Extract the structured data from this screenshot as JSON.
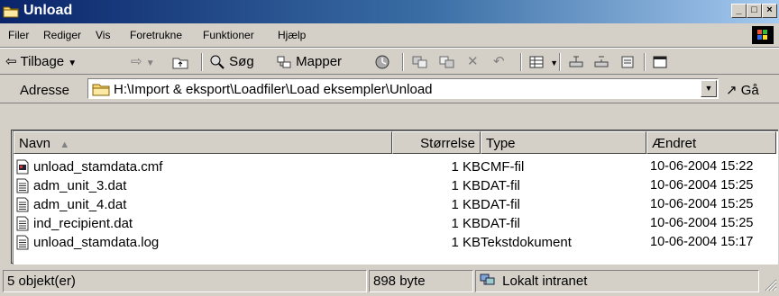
{
  "window": {
    "title": "Unload"
  },
  "menu": [
    "Filer",
    "Rediger",
    "Vis",
    "Foretrukne",
    "Funktioner",
    "Hjælp"
  ],
  "toolbar": {
    "back_label": "Tilbage",
    "search_label": "Søg",
    "folders_label": "Mapper"
  },
  "address": {
    "label": "Adresse",
    "value": "H:\\Import & eksport\\Loadfiler\\Load eksempler\\Unload",
    "go_label": "Gå"
  },
  "columns": {
    "name": "Navn",
    "size": "Størrelse",
    "type": "Type",
    "modified": "Ændret"
  },
  "files": [
    {
      "name": "unload_stamdata.cmf",
      "size": "1 KB",
      "type": "CMF-fil",
      "modified": "10-06-2004 15:22",
      "icon": "cmf-file-icon"
    },
    {
      "name": "adm_unit_3.dat",
      "size": "1 KB",
      "type": "DAT-fil",
      "modified": "10-06-2004 15:25",
      "icon": "text-file-icon"
    },
    {
      "name": "adm_unit_4.dat",
      "size": "1 KB",
      "type": "DAT-fil",
      "modified": "10-06-2004 15:25",
      "icon": "text-file-icon"
    },
    {
      "name": "ind_recipient.dat",
      "size": "1 KB",
      "type": "DAT-fil",
      "modified": "10-06-2004 15:25",
      "icon": "text-file-icon"
    },
    {
      "name": "unload_stamdata.log",
      "size": "1 KB",
      "type": "Tekstdokument",
      "modified": "10-06-2004 15:17",
      "icon": "text-file-icon"
    }
  ],
  "status": {
    "count": "5 objekt(er)",
    "size": "898 byte",
    "zone": "Lokalt intranet"
  },
  "colors": {
    "title_start": "#0a246a",
    "title_end": "#a6caf0",
    "face": "#d4d0c8"
  }
}
